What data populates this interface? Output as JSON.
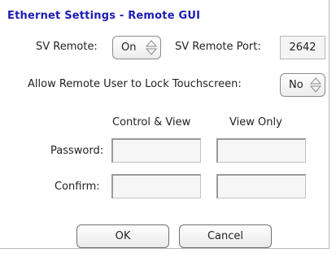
{
  "dialog": {
    "title": "Ethernet Settings - Remote GUI"
  },
  "sv_remote": {
    "label": "SV Remote:",
    "value": "On",
    "port_label": "SV Remote Port:",
    "port_value": "2642"
  },
  "lock": {
    "label": "Allow Remote User to Lock Touchscreen:",
    "value": "No"
  },
  "columns": {
    "control_view": "Control & View",
    "view_only": "View Only"
  },
  "rows": {
    "password_label": "Password:",
    "confirm_label": "Confirm:"
  },
  "buttons": {
    "ok": "OK",
    "cancel": "Cancel"
  },
  "colors": {
    "title": "#1c1cb4"
  }
}
